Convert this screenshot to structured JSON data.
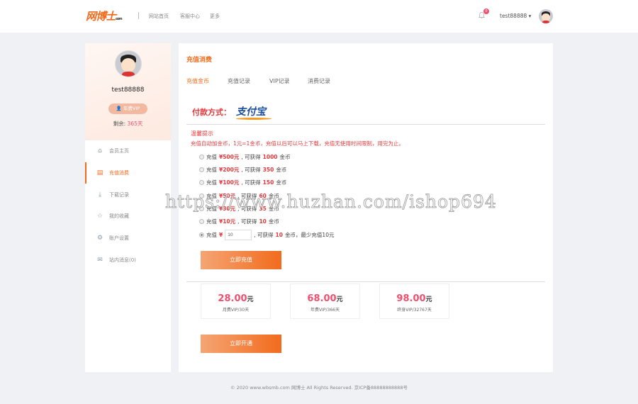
{
  "header": {
    "logo": "网博士",
    "logo_suffix": "com",
    "nav": [
      "网站首页",
      "客服中心",
      "更多"
    ],
    "notif_count": "0",
    "username": "test88888 ▾"
  },
  "sidebar": {
    "username": "test88888",
    "vip_label": "年费VIP",
    "remain_label": "剩余:",
    "remain_value": "365天",
    "items": [
      {
        "icon": "home-icon",
        "glyph": "⌂",
        "label": "会员主页"
      },
      {
        "icon": "recharge-icon",
        "glyph": "▤",
        "label": "充值消费"
      },
      {
        "icon": "download-icon",
        "glyph": "⤓",
        "label": "下载记录"
      },
      {
        "icon": "star-icon",
        "glyph": "☆",
        "label": "我的收藏"
      },
      {
        "icon": "gear-icon",
        "glyph": "⚙",
        "label": "账户设置"
      },
      {
        "icon": "mail-icon",
        "glyph": "✉",
        "label": "站内消息(0)"
      }
    ]
  },
  "main": {
    "title": "充值消费",
    "tabs": [
      "充值金币",
      "充值记录",
      "VIP记录",
      "消费记录"
    ],
    "pay_label": "付款方式：",
    "pay_logo": "支付宝",
    "tip_title": "温馨提示",
    "tip_text": "充值自动加金币，1元=1金币，充值以后可以马上下载，充值无使用时间限制，用完为止。",
    "options": [
      {
        "pre": "充值",
        "price": "¥500元",
        "mid": ", 可获得",
        "coins": "1000",
        "unit": "金币"
      },
      {
        "pre": "充值",
        "price": "¥200元",
        "mid": ", 可获得",
        "coins": "350",
        "unit": "金币"
      },
      {
        "pre": "充值",
        "price": "¥100元",
        "mid": ", 可获得",
        "coins": "150",
        "unit": "金币"
      },
      {
        "pre": "充值",
        "price": "¥50元",
        "mid": ", 可获得",
        "coins": "60",
        "unit": "金币"
      },
      {
        "pre": "充值",
        "price": "¥30元",
        "mid": ", 可获得",
        "coins": "35",
        "unit": "金币"
      },
      {
        "pre": "充值",
        "price": "¥10元",
        "mid": ", 可获得",
        "coins": "10",
        "unit": "金币"
      }
    ],
    "custom": {
      "pre": "充值",
      "yen": "¥",
      "value": "10",
      "mid": ", 可获得",
      "coins": "10",
      "unit": "金币，最少充值10元"
    },
    "recharge_button": "立即充值",
    "vip_cards": [
      {
        "price": "28.00",
        "unit": "元",
        "name": "月费VIP/30天"
      },
      {
        "price": "68.00",
        "unit": "元",
        "name": "年费VIP/366天"
      },
      {
        "price": "98.00",
        "unit": "元",
        "name": "终身VIP/32767天"
      }
    ],
    "vip_button": "立即开通"
  },
  "footer": "© 2020 www.wbsmb.com 网博士 All Rights Reserved. 京ICP备88888888888号",
  "watermark": "https://www.huzhan.com/ishop694"
}
